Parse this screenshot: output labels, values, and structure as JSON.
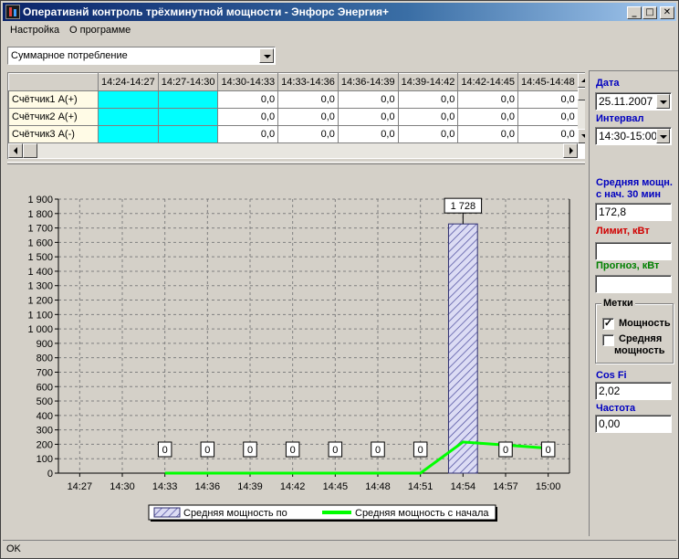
{
  "window": {
    "title": "Оперативнй контроль трёхминутной мощности - Энфорс Энергия+",
    "minimize": "_",
    "maximize": "□",
    "close": "✕"
  },
  "menu": {
    "items": [
      "Настройка",
      "О программе"
    ]
  },
  "mode_select": {
    "value": "Суммарное потребление"
  },
  "grid": {
    "columns": [
      "14:24-14:27",
      "14:27-14:30",
      "14:30-14:33",
      "14:33-14:36",
      "14:36-14:39",
      "14:39-14:42",
      "14:42-14:45",
      "14:45-14:48"
    ],
    "rows": [
      {
        "label": "Счётчик1 А(+)",
        "values": [
          "",
          "",
          "0,0",
          "0,0",
          "0,0",
          "0,0",
          "0,0",
          "0,0"
        ]
      },
      {
        "label": "Счётчик2 А(+)",
        "values": [
          "",
          "",
          "0,0",
          "0,0",
          "0,0",
          "0,0",
          "0,0",
          "0,0"
        ]
      },
      {
        "label": "Счётчик3 А(-)",
        "values": [
          "",
          "",
          "0,0",
          "0,0",
          "0,0",
          "0,0",
          "0,0",
          "0,0"
        ]
      }
    ],
    "highlight_color": "#00ffff"
  },
  "side": {
    "date_label": "Дата",
    "date_value": "25.11.2007",
    "interval_label": "Интервал",
    "interval_value": "14:30-15:00",
    "avg_label_1": "Средняя мощн.",
    "avg_label_2": "с нач. 30 мин",
    "avg_value": "172,8",
    "limit_label": "Лимит, кВт",
    "limit_value": "",
    "forecast_label": "Прогноз, кВт",
    "forecast_value": "",
    "marks_title": "Метки",
    "mark_power_label": "Мощность",
    "mark_power_checked": true,
    "mark_avg_label_1": "Средняя",
    "mark_avg_label_2": "мощность",
    "mark_avg_checked": false,
    "cosfi_label": "Cos Fi",
    "cosfi_value": "2,02",
    "freq_label": "Частота",
    "freq_value": "0,00"
  },
  "status": {
    "text": "OK"
  },
  "chart_data": {
    "type": "bar",
    "title": "",
    "xlabel": "",
    "ylabel": "",
    "ylim": [
      0,
      1900
    ],
    "yticks": [
      0,
      100,
      200,
      300,
      400,
      500,
      600,
      700,
      800,
      900,
      1000,
      1100,
      1200,
      1300,
      1400,
      1500,
      1600,
      1700,
      1800,
      1900
    ],
    "ytick_labels": [
      "0",
      "100",
      "200",
      "300",
      "400",
      "500",
      "600",
      "700",
      "800",
      "900",
      "1 000",
      "1 100",
      "1 200",
      "1 300",
      "1 400",
      "1 500",
      "1 600",
      "1 700",
      "1 800",
      "1 900"
    ],
    "categories": [
      "14:27",
      "14:30",
      "14:33",
      "14:36",
      "14:39",
      "14:42",
      "14:45",
      "14:48",
      "14:51",
      "14:54",
      "14:57",
      "15:00"
    ],
    "series": [
      {
        "name": "Средняя мощность по",
        "kind": "bar",
        "color": "#8080c0",
        "values": [
          null,
          null,
          0,
          0,
          0,
          0,
          0,
          0,
          0,
          1728,
          0,
          0
        ],
        "labels": [
          null,
          null,
          "0",
          "0",
          "0",
          "0",
          "0",
          "0",
          "0",
          "1 728",
          "0",
          "0"
        ]
      },
      {
        "name": "Средняя мощность с начала",
        "kind": "line",
        "color": "#00ff00",
        "values": [
          null,
          null,
          0,
          0,
          0,
          0,
          0,
          0,
          0,
          216,
          195,
          172.8
        ]
      }
    ],
    "grid": true,
    "legend": "bottom"
  }
}
